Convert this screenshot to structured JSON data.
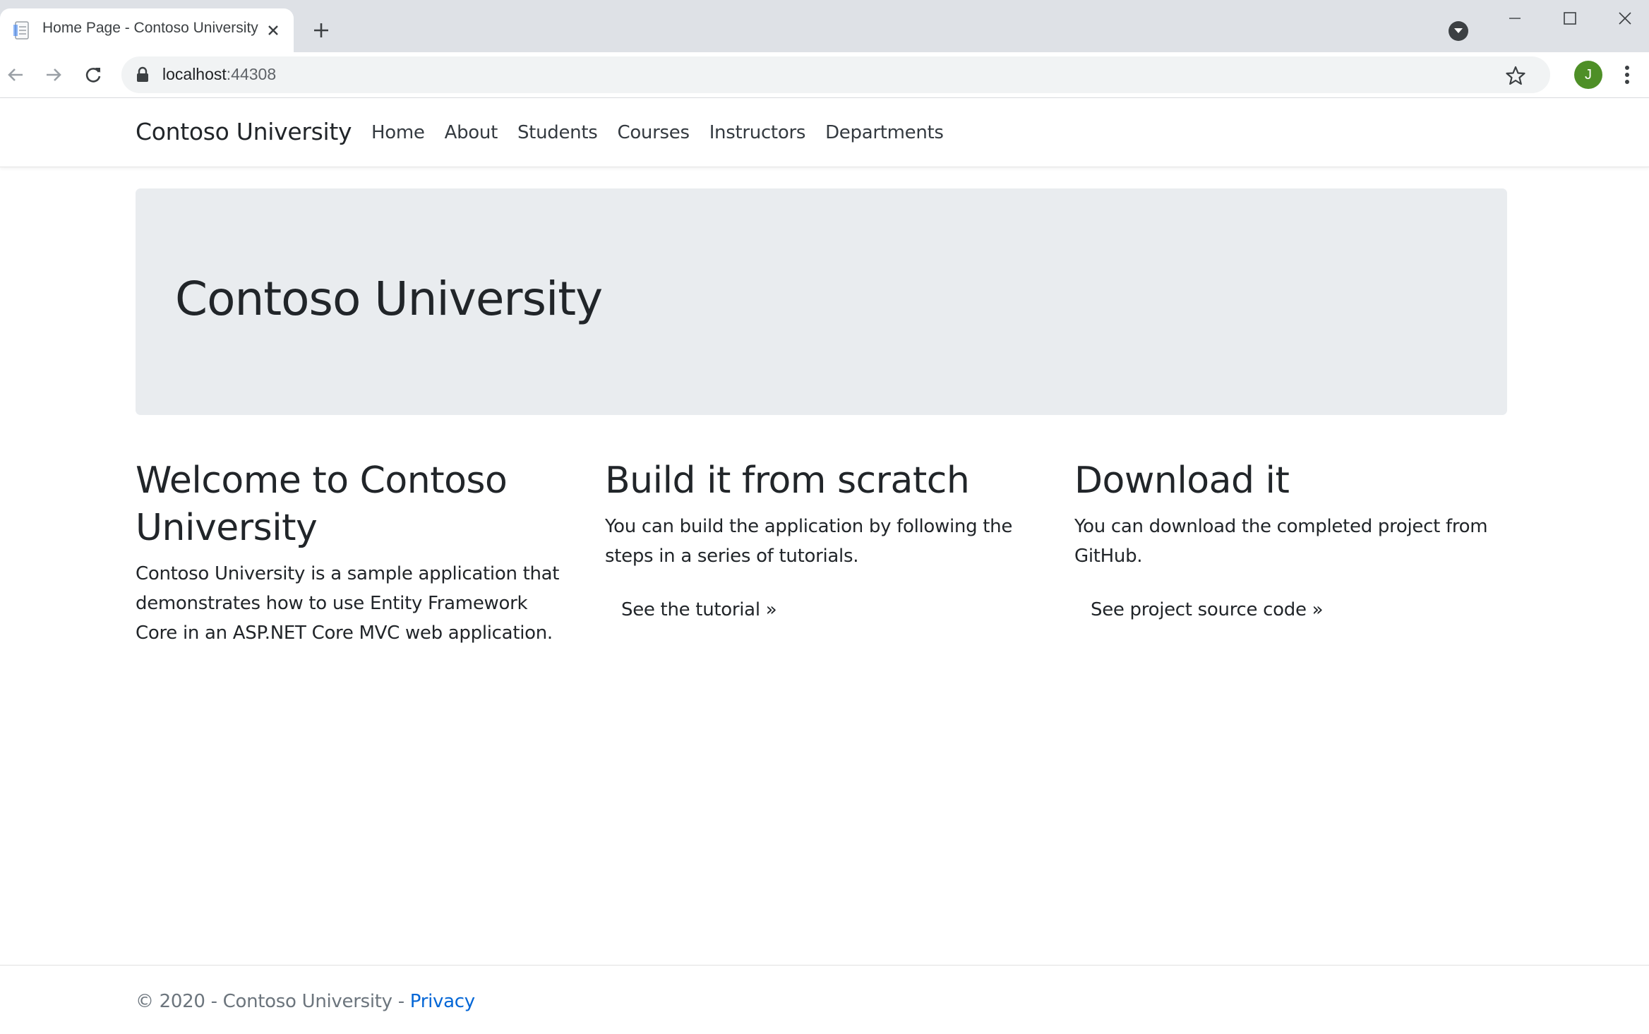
{
  "browser": {
    "tab_title": "Home Page - Contoso University",
    "url_host": "localhost",
    "url_port": ":44308",
    "profile_initial": "J"
  },
  "site": {
    "brand": "Contoso University",
    "nav": [
      "Home",
      "About",
      "Students",
      "Courses",
      "Instructors",
      "Departments"
    ],
    "hero_title": "Contoso University",
    "columns": [
      {
        "heading": "Welcome to Contoso University",
        "text": "Contoso University is a sample application that demonstrates how to use Entity Framework Core in an ASP.NET Core MVC web application.",
        "link": ""
      },
      {
        "heading": "Build it from scratch",
        "text": "You can build the application by following the steps in a series of tutorials.",
        "link": "See the tutorial »"
      },
      {
        "heading": "Download it",
        "text": "You can download the completed project from GitHub.",
        "link": "See project source code »"
      }
    ],
    "footer_text": "© 2020 - Contoso University - ",
    "footer_link": "Privacy"
  },
  "colors": {
    "jumbotron_bg": "#e9ecef",
    "link": "#0366d6",
    "avatar": "#4e8f27"
  }
}
